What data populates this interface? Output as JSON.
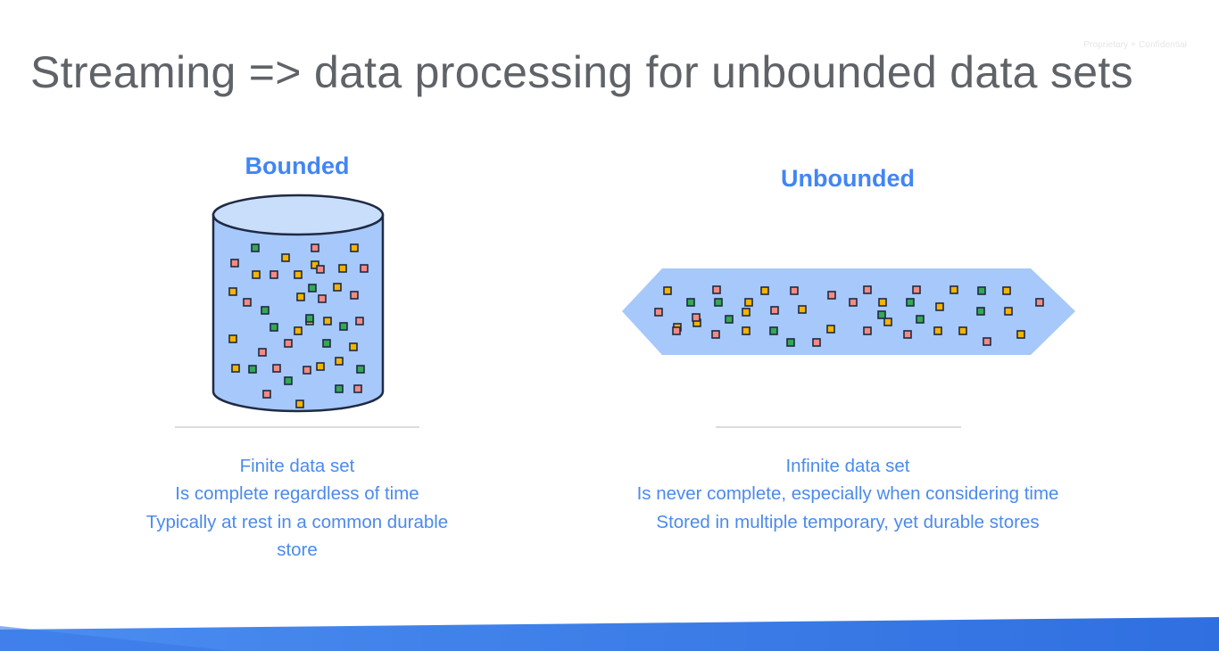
{
  "watermark": "Proprietary + Confidential",
  "title": "Streaming => data processing for unbounded data sets",
  "bounded": {
    "heading": "Bounded",
    "lines": [
      "Finite data set",
      "Is complete regardless of time",
      "Typically at rest in a common durable",
      "store"
    ]
  },
  "unbounded": {
    "heading": "Unbounded",
    "lines": [
      "Infinite data set",
      "Is never complete, especially when considering time",
      "Stored in multiple temporary, yet durable stores"
    ]
  },
  "colors": {
    "accent": "#4285f4",
    "title": "#5f6368",
    "shape_fill": "#a6c8fa",
    "shape_stroke": "#1f2a44",
    "dot_palette": [
      "#f4b400",
      "#f28b82",
      "#34a853"
    ]
  }
}
